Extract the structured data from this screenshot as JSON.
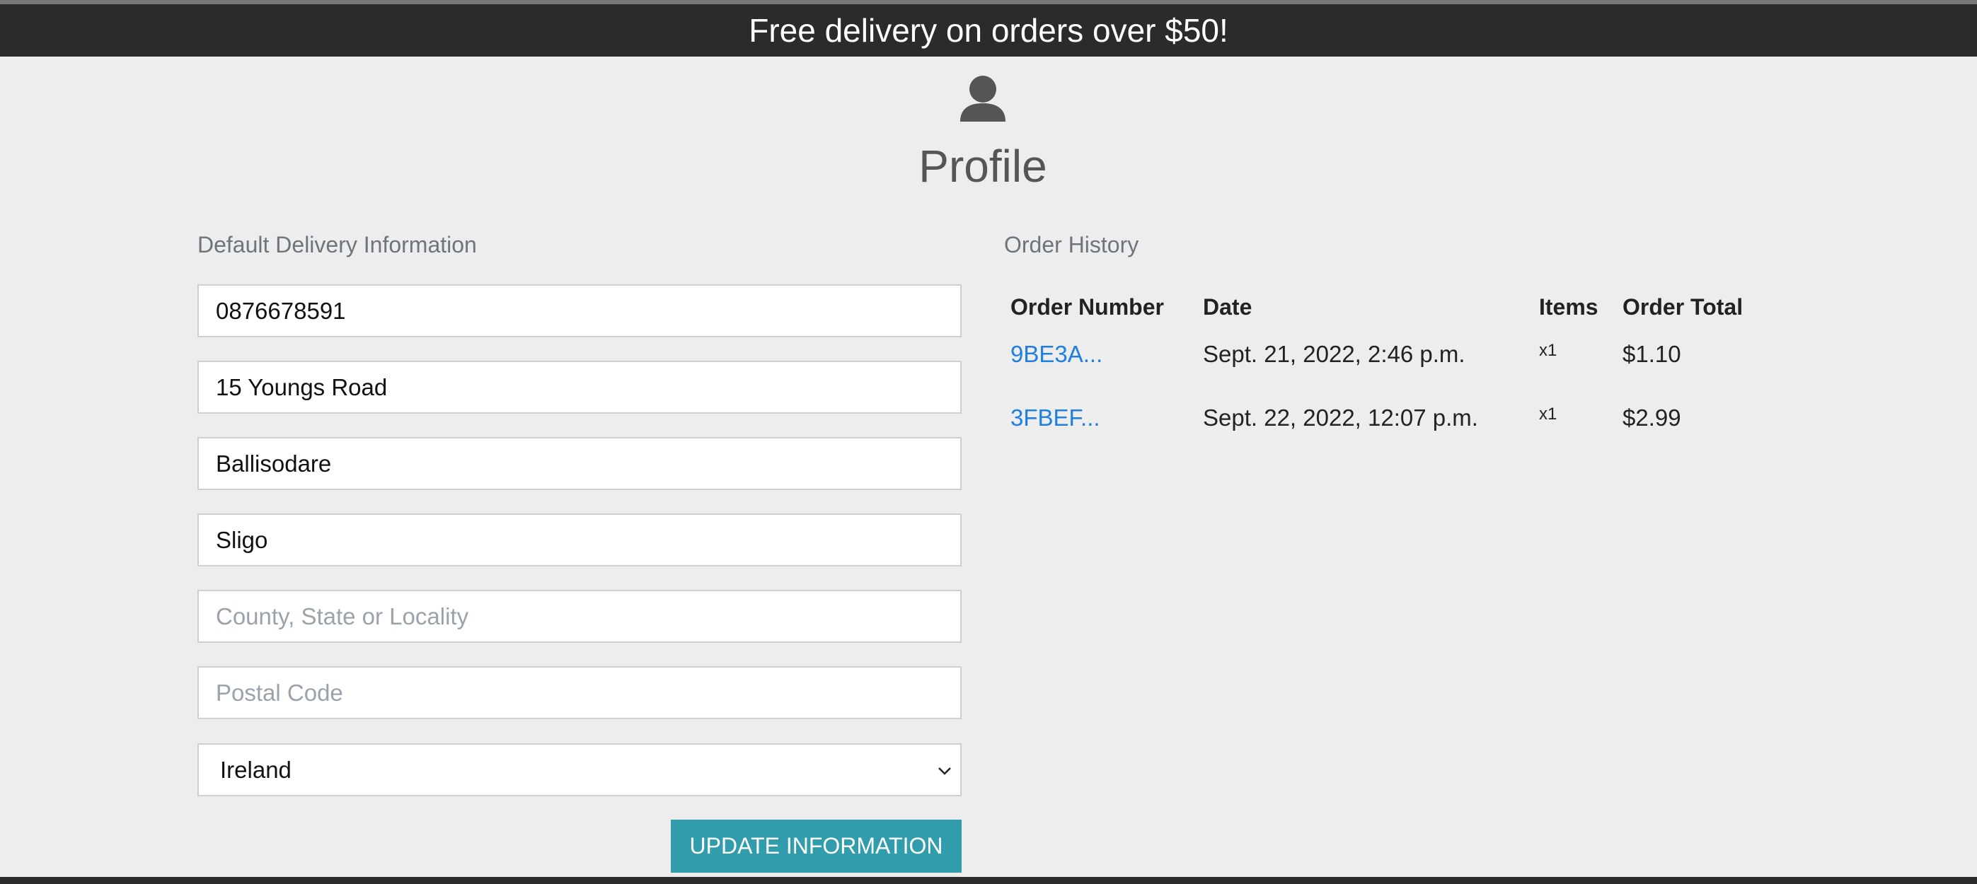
{
  "banner": {
    "text": "Free delivery on orders over $50!"
  },
  "page": {
    "title": "Profile",
    "icon": "user-icon"
  },
  "delivery": {
    "heading": "Default Delivery Information",
    "fields": [
      {
        "name": "phone-number-field",
        "value": "0876678591",
        "placeholder": ""
      },
      {
        "name": "street-address-field",
        "value": "15 Youngs Road",
        "placeholder": ""
      },
      {
        "name": "town-city-field",
        "value": "Ballisodare",
        "placeholder": ""
      },
      {
        "name": "street-address-2-field",
        "value": "Sligo",
        "placeholder": ""
      },
      {
        "name": "county-field",
        "value": "",
        "placeholder": "County, State or Locality"
      },
      {
        "name": "postal-code-field",
        "value": "",
        "placeholder": "Postal Code"
      }
    ],
    "country": {
      "selected": "Ireland"
    },
    "submit_label": "UPDATE INFORMATION"
  },
  "orders": {
    "heading": "Order History",
    "columns": [
      "Order Number",
      "Date",
      "Items",
      "Order Total"
    ],
    "rows": [
      {
        "number": "9BE3A...",
        "date": "Sept. 21, 2022, 2:46 p.m.",
        "items": "x1",
        "total": "$1.10"
      },
      {
        "number": "3FBEF...",
        "date": "Sept. 22, 2022, 12:07 p.m.",
        "items": "x1",
        "total": "$2.99"
      }
    ]
  },
  "colors": {
    "banner_bg": "#2b2b2b",
    "button_bg": "#319dac",
    "link": "#1e7fe0",
    "page_bg": "#ededed"
  }
}
